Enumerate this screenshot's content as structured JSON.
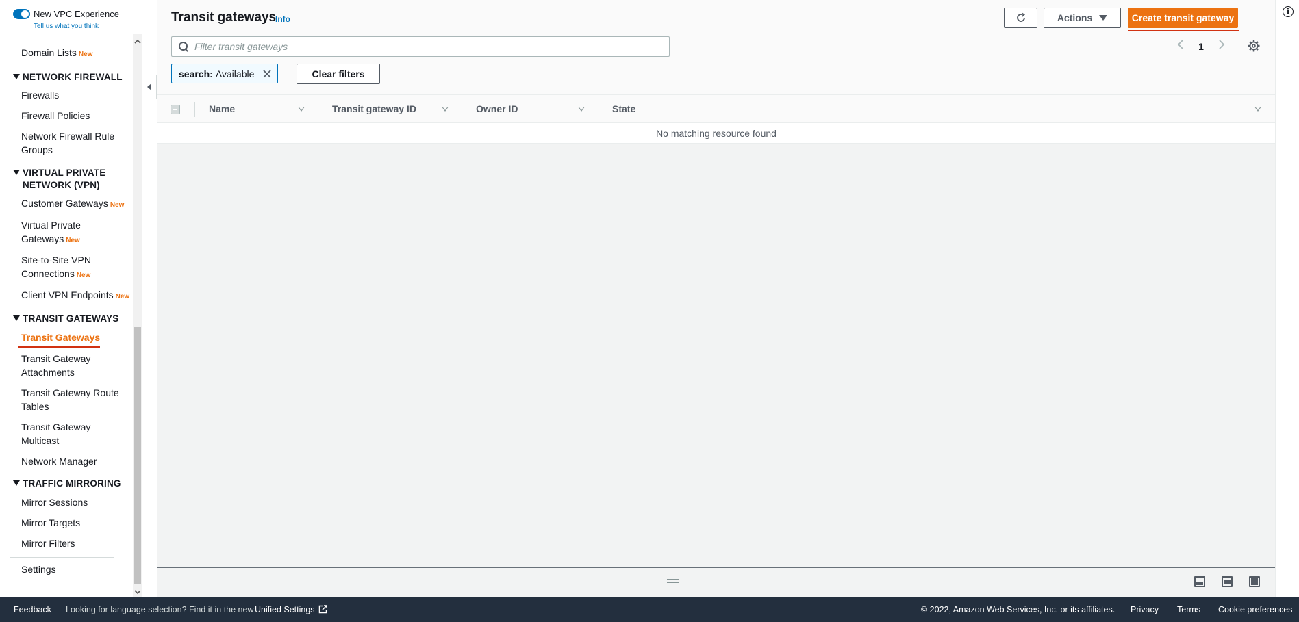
{
  "sidebar": {
    "vpc_toggle_label": "New VPC Experience",
    "vpc_feedback_link": "Tell us what you think",
    "new_badge": "New",
    "items": {
      "domain_lists": "Domain Lists",
      "firewalls": "Firewalls",
      "firewall_policies": "Firewall Policies",
      "network_firewall_rule_groups": "Network Firewall Rule Groups",
      "customer_gateways": "Customer Gateways",
      "virtual_private_gateways": "Virtual Private Gateways",
      "site_to_site_vpn": "Site-to-Site VPN Connections",
      "client_vpn_endpoints": "Client VPN Endpoints",
      "transit_gateways": "Transit Gateways",
      "transit_gateway_attachments": "Transit Gateway Attachments",
      "transit_gateway_route_tables": "Transit Gateway Route Tables",
      "transit_gateway_multicast": "Transit Gateway Multicast",
      "network_manager": "Network Manager",
      "mirror_sessions": "Mirror Sessions",
      "mirror_targets": "Mirror Targets",
      "mirror_filters": "Mirror Filters",
      "settings": "Settings"
    },
    "sections": {
      "network_firewall": "NETWORK FIREWALL",
      "vpn": "VIRTUAL PRIVATE NETWORK (VPN)",
      "transit_gateways": "TRANSIT GATEWAYS",
      "traffic_mirroring": "TRAFFIC MIRRORING"
    },
    "active_item": "Transit Gateways"
  },
  "header": {
    "title": "Transit gateways",
    "info_link": "Info",
    "actions_label": "Actions",
    "create_label": "Create transit gateway"
  },
  "search": {
    "placeholder": "Filter transit gateways",
    "value": ""
  },
  "filter_token": {
    "key": "search:",
    "value": "Available"
  },
  "clear_filters_label": "Clear filters",
  "pagination": {
    "current_page": "1"
  },
  "table": {
    "columns": [
      "Name",
      "Transit gateway ID",
      "Owner ID",
      "State"
    ],
    "empty_message": "No matching resource found"
  },
  "footer": {
    "feedback": "Feedback",
    "language_notice": "Looking for language selection? Find it in the new",
    "unified_settings": "Unified Settings",
    "copyright": "© 2022, Amazon Web Services, Inc. or its affiliates.",
    "privacy": "Privacy",
    "terms": "Terms",
    "cookie_preferences": "Cookie preferences"
  },
  "colors": {
    "accent_orange": "#ec7211",
    "link_blue": "#0073bb",
    "footer_bg": "#232f3e",
    "underline_red": "#d13212"
  },
  "icons": [
    "toggle-switch",
    "caret-down-icon",
    "refresh-icon",
    "dropdown-caret-icon",
    "search-icon",
    "chevron-left-icon",
    "chevron-right-icon",
    "gear-icon",
    "close-icon",
    "sort-icon",
    "external-link-icon",
    "info-icon",
    "panel-bottom-icon",
    "panel-side-icon",
    "panel-full-icon"
  ]
}
